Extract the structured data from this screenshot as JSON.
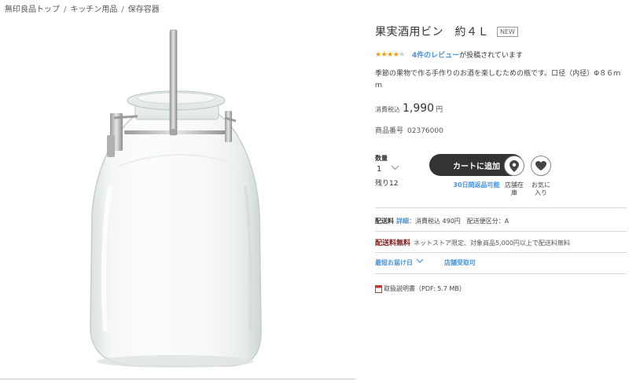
{
  "breadcrumb": {
    "items": [
      "無印良品トップ",
      "キッチン用品",
      "保存容器"
    ],
    "separator": "/"
  },
  "product": {
    "title": "果実酒用ビン　約４Ｌ",
    "badge": "NEW",
    "rating": {
      "stars": 4,
      "max": 5,
      "filled_glyph": "★★★★",
      "empty_glyph": "★"
    },
    "review_link": "4件のレビュー",
    "review_suffix": "が投稿されています",
    "description": "季節の果物で作る手作りのお酒を楽しむための瓶です。口径（内径）Φ８６ｍｍ",
    "price_label": "消費税込",
    "price": "1,990",
    "price_unit": "円",
    "sku_label": "商品番号",
    "sku": "02376000"
  },
  "purchase": {
    "qty_label": "数量",
    "qty_value": "1",
    "stock_left": "残り12",
    "cart_button": "カートに追加",
    "returns_note": "30日間返品可能",
    "store_stock_label": "店舗在庫",
    "favorite_label": "お気に入り",
    "store_stock_icon": "map-pin-icon",
    "favorite_icon": "heart-icon"
  },
  "shipping": {
    "label": "配送料",
    "detail_link": "詳細",
    "fee_text": "：消費税込 490円　配送便区分：A",
    "free_tag": "配送料無料",
    "free_text": "ネットストア限定、対象商品5,000円以上で配送料無料",
    "earliest_delivery": "最短お届け日",
    "store_pickup": "店舗受取可",
    "manual": "取扱説明書（PDF: 5.7 MB）",
    "manual_icon": "pdf-icon"
  },
  "colors": {
    "accent_link": "#4b93d7",
    "star": "#f0a000",
    "free_shipping": "#7f1b1b",
    "cart_button_bg": "#333333"
  }
}
